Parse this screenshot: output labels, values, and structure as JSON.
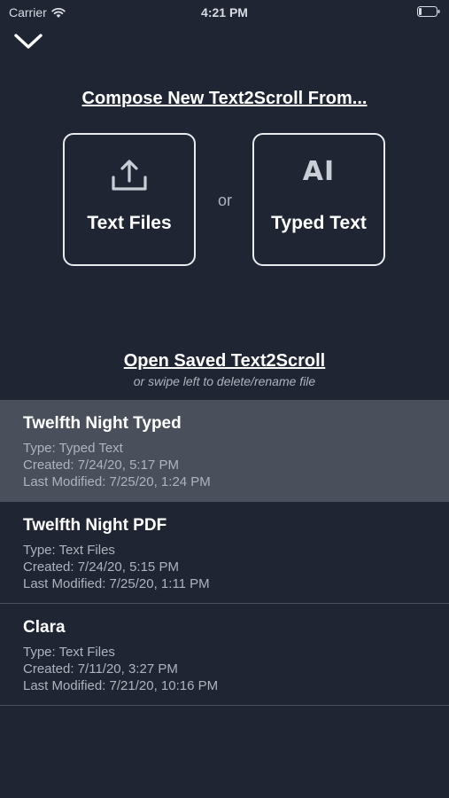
{
  "status_bar": {
    "carrier": "Carrier",
    "time": "4:21 PM"
  },
  "compose": {
    "title": "Compose New Text2Scroll From...",
    "or_label": "or",
    "options": [
      {
        "label": "Text Files",
        "icon": "upload-icon"
      },
      {
        "label": "Typed Text",
        "icon": "typed-text-icon",
        "glyph": "AI"
      }
    ]
  },
  "saved": {
    "title": "Open Saved Text2Scroll",
    "subtitle": "or swipe left to delete/rename file",
    "files": [
      {
        "name": "Twelfth Night Typed",
        "type": "Type: Typed Text",
        "created": "Created: 7/24/20, 5:17 PM",
        "modified": "Last Modified: 7/25/20, 1:24 PM",
        "selected": true
      },
      {
        "name": "Twelfth Night PDF",
        "type": "Type: Text Files",
        "created": "Created: 7/24/20, 5:15 PM",
        "modified": "Last Modified: 7/25/20, 1:11 PM",
        "selected": false
      },
      {
        "name": "Clara",
        "type": "Type: Text Files",
        "created": "Created: 7/11/20, 3:27 PM",
        "modified": "Last Modified: 7/21/20, 10:16 PM",
        "selected": false
      }
    ]
  },
  "colors": {
    "background": "#1f2533",
    "selected_row": "#4a505b",
    "divider": "#4a5160",
    "secondary_text": "#aeb3bd"
  }
}
